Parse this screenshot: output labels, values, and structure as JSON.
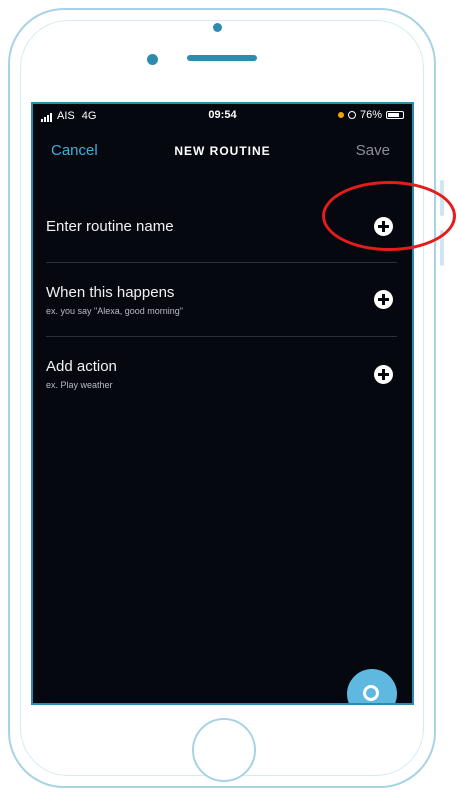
{
  "status_bar": {
    "carrier": "AIS",
    "network": "4G",
    "time": "09:54",
    "battery": "76%"
  },
  "nav": {
    "cancel_label": "Cancel",
    "title": "NEW ROUTINE",
    "save_label": "Save"
  },
  "rows": [
    {
      "title": "Enter routine name",
      "subtitle": ""
    },
    {
      "title": "When this happens",
      "subtitle": "ex. you say \"Alexa, good morning\""
    },
    {
      "title": "Add action",
      "subtitle": "ex. Play weather"
    }
  ],
  "icons": {
    "add": "plus-circle-icon",
    "assistant": "alexa-icon"
  },
  "colors": {
    "accent": "#3fb0e0",
    "background": "#05080e",
    "highlight": "#e31c1c",
    "alexa_button": "#5fb8df"
  }
}
